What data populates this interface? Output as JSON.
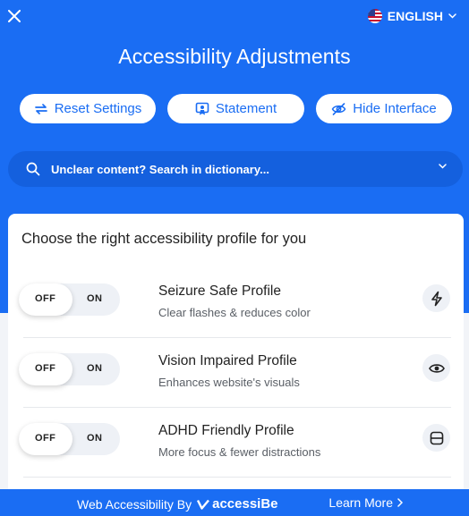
{
  "header": {
    "language": "ENGLISH",
    "title": "Accessibility Adjustments"
  },
  "actions": {
    "reset": "Reset Settings",
    "statement": "Statement",
    "hide": "Hide Interface"
  },
  "search": {
    "placeholder": "Unclear content? Search in dictionary..."
  },
  "profiles": {
    "heading": "Choose the right accessibility profile for you",
    "items": [
      {
        "name": "Seizure Safe Profile",
        "description": "Clear flashes & reduces color",
        "off_label": "OFF",
        "on_label": "ON",
        "state": "off",
        "icon": "lightning-icon"
      },
      {
        "name": "Vision Impaired Profile",
        "description": "Enhances website's visuals",
        "off_label": "OFF",
        "on_label": "ON",
        "state": "off",
        "icon": "eye-icon"
      },
      {
        "name": "ADHD Friendly Profile",
        "description": "More focus & fewer distractions",
        "off_label": "OFF",
        "on_label": "ON",
        "state": "off",
        "icon": "focus-frame-icon"
      }
    ]
  },
  "footer": {
    "prefix": "Web Accessibility By",
    "brand": "accessiBe",
    "learn_more": "Learn More"
  },
  "colors": {
    "accent": "#1a6df3",
    "search_bg": "#1460de",
    "card_bg": "#ffffff",
    "panel_bg": "#f2f4f8"
  }
}
